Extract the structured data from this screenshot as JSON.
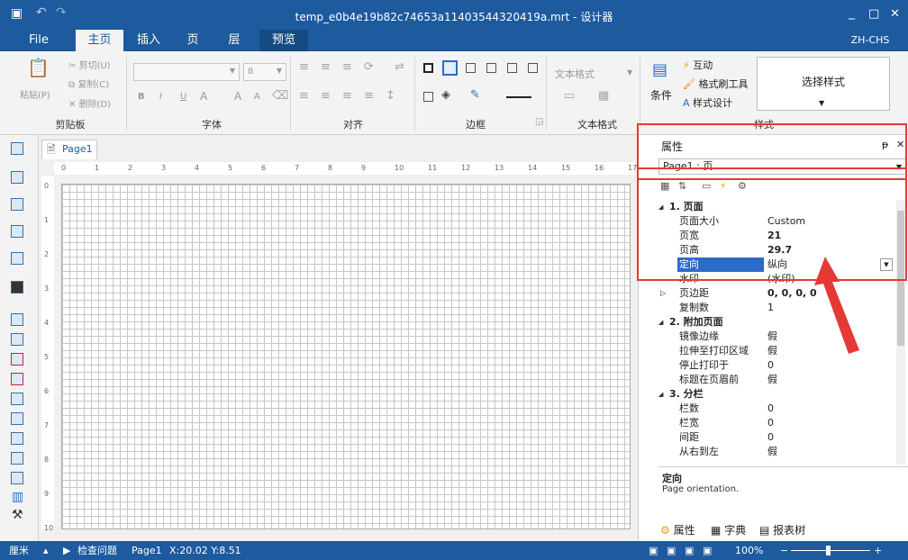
{
  "window": {
    "title": "temp_e0b4e19b82c74653a11403544320419a.mrt - 设计器",
    "save_icon": "save-icon",
    "undo_icon": "undo-icon",
    "redo_icon": "redo-icon",
    "min": "_",
    "max": "□",
    "close": "✕"
  },
  "menu": {
    "file": "File",
    "tabs": [
      "主页",
      "插入",
      "页",
      "层",
      "预览"
    ],
    "lang": "ZH-CHS"
  },
  "ribbon": {
    "clipboard": {
      "paste": "粘贴(P)",
      "cut": "剪切(U)",
      "copy": "复制(C)",
      "delete": "删除(D)",
      "label": "剪贴板"
    },
    "font": {
      "size": "8",
      "label": "字体",
      "bold": "B",
      "italic": "I",
      "underline": "U",
      "fontA": "A",
      "growA": "A",
      "shrinkA": "A"
    },
    "align": {
      "label": "对齐"
    },
    "border": {
      "label": "边框"
    },
    "textformat": {
      "value": "文本格式",
      "label": "文本格式"
    },
    "style": {
      "interaction": "互动",
      "painter": "格式刷工具",
      "designer": "样式设计",
      "condition": "条件",
      "select": "选择样式",
      "label": "样式"
    }
  },
  "document": {
    "page_tab": "Page1",
    "ruler_h": [
      "0",
      "1",
      "2",
      "3",
      "4",
      "5",
      "6",
      "7",
      "8",
      "9",
      "10",
      "11",
      "12",
      "13",
      "14",
      "15",
      "16",
      "17"
    ],
    "ruler_v": [
      "0",
      "1",
      "2",
      "3",
      "4",
      "5",
      "6",
      "7",
      "8",
      "9",
      "10"
    ]
  },
  "properties": {
    "title": "属性",
    "pin": "ᵽ",
    "close": "✕",
    "selector": "Page1 : 页",
    "categories": [
      {
        "name": "1. 页面",
        "rows": [
          [
            "页面大小",
            "Custom"
          ],
          [
            "页宽",
            "21"
          ],
          [
            "页高",
            "29.7"
          ],
          [
            "定向",
            "纵向"
          ],
          [
            "水印",
            "(水印)"
          ],
          [
            "页边距",
            "0, 0, 0, 0"
          ],
          [
            "复制数",
            "1"
          ]
        ]
      },
      {
        "name": "2. 附加页面",
        "rows": [
          [
            "镜像边缘",
            "假"
          ],
          [
            "拉伸至打印区域",
            "假"
          ],
          [
            "停止打印于",
            "0"
          ],
          [
            "标题在页眉前",
            "假"
          ]
        ]
      },
      {
        "name": "3. 分栏",
        "rows": [
          [
            "栏数",
            "0"
          ],
          [
            "栏宽",
            "0"
          ],
          [
            "间距",
            "0"
          ],
          [
            "从右到左",
            "假"
          ]
        ]
      }
    ],
    "desc_title": "定向",
    "desc_text": "Page orientation.",
    "bottom_tabs": [
      "属性",
      "字典",
      "报表树"
    ]
  },
  "status": {
    "unit": "厘米",
    "check": "检查问题",
    "page": "Page1",
    "coords": "X:20.02 Y:8.51",
    "zoom": "100%"
  }
}
